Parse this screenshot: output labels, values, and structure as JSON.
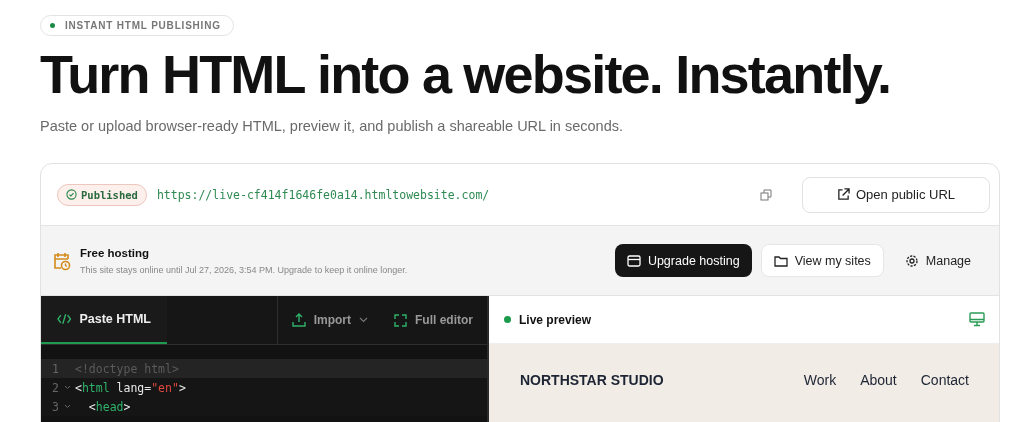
{
  "eyebrow": {
    "label": "INSTANT HTML PUBLISHING"
  },
  "headline": "Turn HTML into a website. Instantly.",
  "subtitle": "Paste or upload browser-ready HTML, preview it, and publish a shareable URL in seconds.",
  "publish_bar": {
    "status": "Published",
    "url": "https://live-cf414f1646fe0a14.htmltowebsite.com/",
    "open_button": "Open public URL"
  },
  "hosting_bar": {
    "title": "Free hosting",
    "note": "This site stays online until Jul 27, 2026, 3:54 PM. Upgrade to keep it online longer.",
    "buttons": [
      {
        "label": "Upgrade hosting",
        "kind": "primary"
      },
      {
        "label": "View my sites",
        "kind": "secondary"
      },
      {
        "label": "Manage",
        "kind": "plain"
      }
    ]
  },
  "editor": {
    "tabs": [
      {
        "label": "Paste HTML",
        "selected": true
      }
    ],
    "actions": [
      {
        "label": "Import",
        "kind": "dropdown"
      },
      {
        "label": "Full editor",
        "kind": "expand"
      }
    ],
    "lines": [
      {
        "number": "1",
        "foldable": false,
        "active": true,
        "tokens": [
          {
            "kind": "faded",
            "text": "<!doctype html>"
          }
        ]
      },
      {
        "number": "2",
        "foldable": true,
        "active": false,
        "tokens": [
          {
            "kind": "punct",
            "text": "<"
          },
          {
            "kind": "tag",
            "text": "html"
          },
          {
            "kind": "attr",
            "text": " lang="
          },
          {
            "kind": "string",
            "text": "\"en\""
          },
          {
            "kind": "punct",
            "text": ">"
          }
        ]
      },
      {
        "number": "3",
        "foldable": true,
        "active": false,
        "tokens": [
          {
            "kind": "punct",
            "text": "  <"
          },
          {
            "kind": "tag",
            "text": "head"
          },
          {
            "kind": "punct",
            "text": ">"
          }
        ]
      }
    ]
  },
  "preview": {
    "title": "Live preview",
    "brand": "NORTHSTAR STUDIO",
    "nav": [
      "Work",
      "About",
      "Contact"
    ]
  }
}
